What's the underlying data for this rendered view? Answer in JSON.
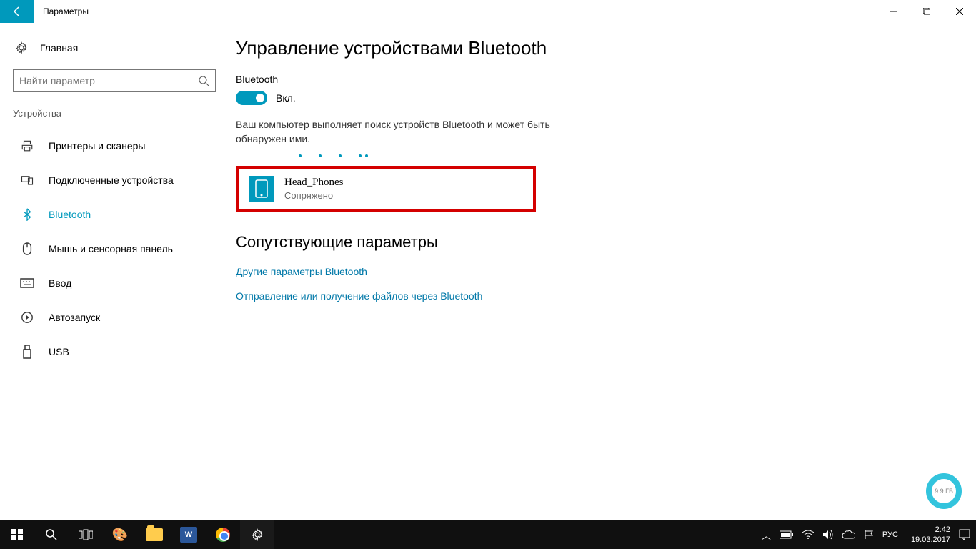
{
  "titlebar": {
    "title": "Параметры"
  },
  "sidebar": {
    "home": "Главная",
    "search_placeholder": "Найти параметр",
    "section": "Устройства",
    "items": [
      {
        "label": "Принтеры и сканеры"
      },
      {
        "label": "Подключенные устройства"
      },
      {
        "label": "Bluetooth"
      },
      {
        "label": "Мышь и сенсорная панель"
      },
      {
        "label": "Ввод"
      },
      {
        "label": "Автозапуск"
      },
      {
        "label": "USB"
      }
    ]
  },
  "main": {
    "title": "Управление устройствами Bluetooth",
    "bt_label": "Bluetooth",
    "toggle_state": "Вкл.",
    "desc": "Ваш компьютер выполняет поиск устройств Bluetooth и может быть обнаружен ими.",
    "device": {
      "name": "Head_Phones",
      "status": "Сопряжено"
    },
    "related_title": "Сопутствующие параметры",
    "link1": "Другие параметры Bluetooth",
    "link2": "Отправление или получение файлов через Bluetooth"
  },
  "floating": {
    "label": "9.9 ГБ"
  },
  "taskbar": {
    "lang": "РУС",
    "time": "2:42",
    "date": "19.03.2017"
  }
}
